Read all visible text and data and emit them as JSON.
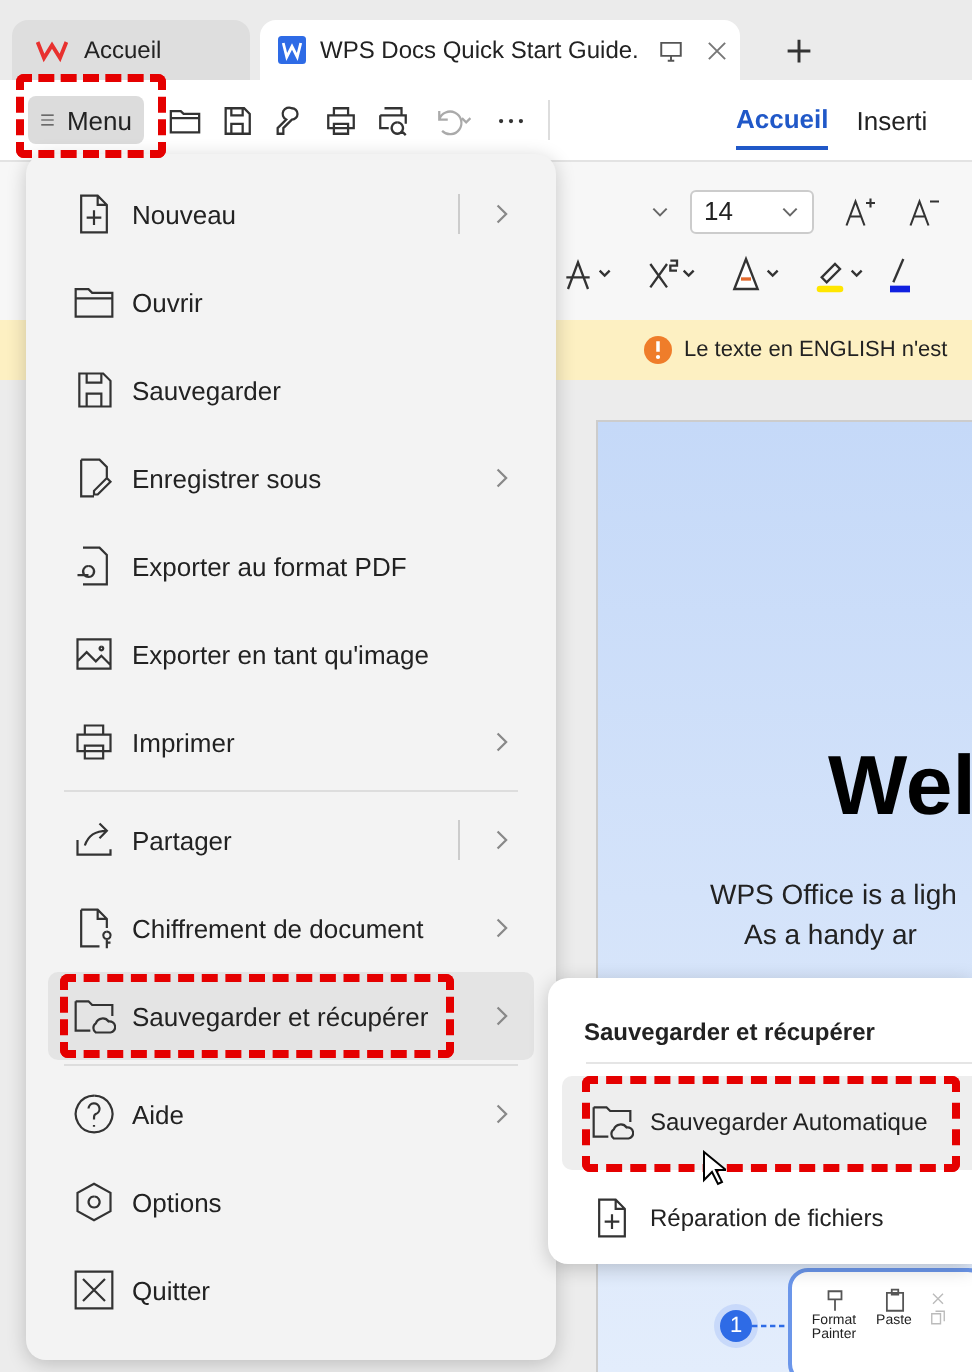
{
  "tabs": [
    {
      "label": "Accueil",
      "selected": false,
      "kind": "home"
    },
    {
      "label": "WPS Docs Quick Start Guide.",
      "selected": true,
      "kind": "document"
    }
  ],
  "menu_button": {
    "label": "Menu",
    "annotated": true
  },
  "ribbon_tabs": [
    {
      "label": "Accueil",
      "selected": true
    },
    {
      "label": "Inserti",
      "selected": false
    }
  ],
  "font_size": {
    "value": "14"
  },
  "notice": {
    "text": "Le texte en ENGLISH n'est"
  },
  "document": {
    "heading": "Wel",
    "lines": [
      "WPS Office is a ligh",
      "As a handy ar"
    ]
  },
  "menu": {
    "groups": [
      {
        "items": [
          {
            "label": "Nouveau",
            "submenu": true,
            "split": true,
            "selected": false,
            "annotated": false
          },
          {
            "label": "Ouvrir",
            "submenu": false,
            "split": false,
            "selected": false,
            "annotated": false
          },
          {
            "label": "Sauvegarder",
            "submenu": false,
            "split": false,
            "selected": false,
            "annotated": false
          },
          {
            "label": "Enregistrer sous",
            "submenu": true,
            "split": false,
            "selected": false,
            "annotated": false
          },
          {
            "label": "Exporter au format PDF",
            "submenu": false,
            "split": false,
            "selected": false,
            "annotated": false
          },
          {
            "label": "Exporter en tant qu'image",
            "submenu": false,
            "split": false,
            "selected": false,
            "annotated": false
          },
          {
            "label": "Imprimer",
            "submenu": true,
            "split": false,
            "selected": false,
            "annotated": false
          }
        ]
      },
      {
        "items": [
          {
            "label": "Partager",
            "submenu": true,
            "split": true,
            "selected": false,
            "annotated": false
          },
          {
            "label": "Chiffrement de document",
            "submenu": true,
            "split": false,
            "selected": false,
            "annotated": false
          },
          {
            "label": "Sauvegarder et récupérer",
            "submenu": true,
            "split": false,
            "selected": true,
            "annotated": true
          }
        ]
      },
      {
        "items": [
          {
            "label": "Aide",
            "submenu": true,
            "split": false,
            "selected": false,
            "annotated": false
          },
          {
            "label": "Options",
            "submenu": false,
            "split": false,
            "selected": false,
            "annotated": false
          },
          {
            "label": "Quitter",
            "submenu": false,
            "split": false,
            "selected": false,
            "annotated": false
          }
        ]
      }
    ]
  },
  "submenu": {
    "title": "Sauvegarder et récupérer",
    "items": [
      {
        "label": "Sauvegarder Automatique",
        "selected": true,
        "annotated": true
      },
      {
        "label": "Réparation de fichiers",
        "selected": false,
        "annotated": false
      }
    ]
  },
  "floating_toolbar": {
    "step": "1",
    "buttons": [
      {
        "label": "Format Painter"
      },
      {
        "label": "Paste"
      }
    ]
  }
}
